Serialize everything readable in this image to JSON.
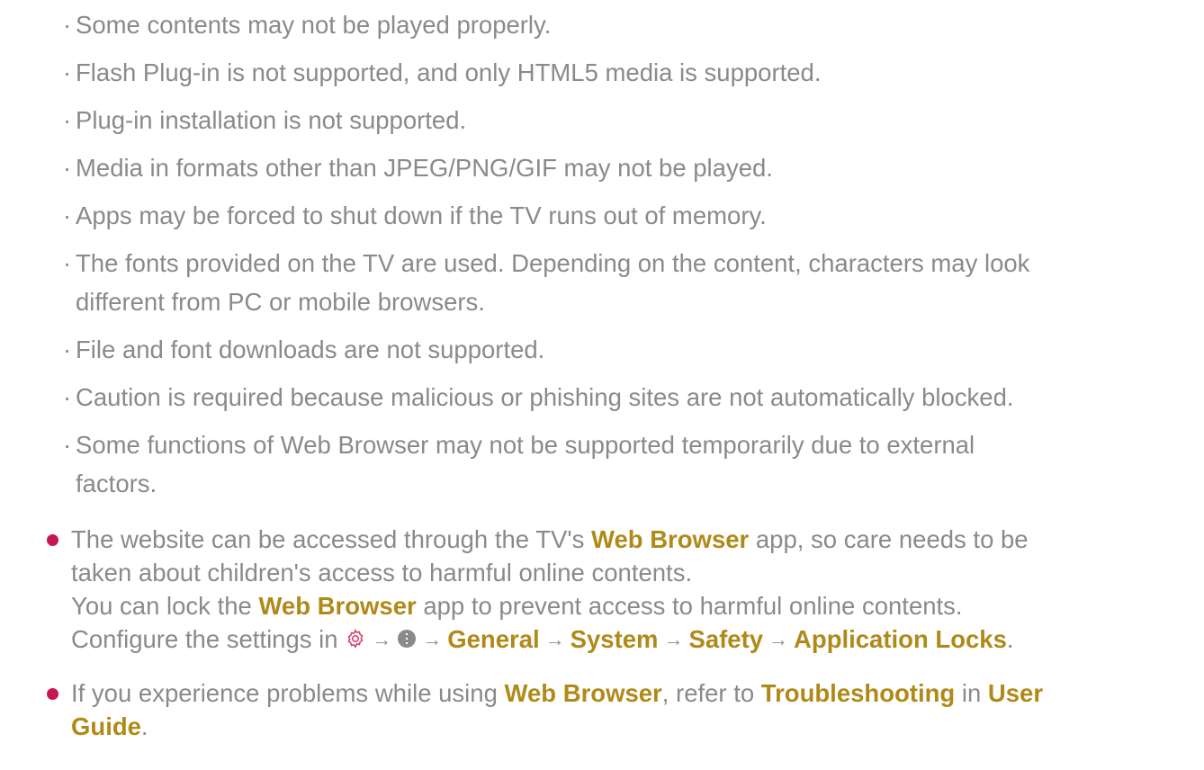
{
  "notes": [
    "Some contents may not be played properly.",
    "Flash Plug-in is not supported, and only HTML5 media is supported.",
    "Plug-in installation is not supported.",
    "Media in formats other than JPEG/PNG/GIF may not be played.",
    "Apps may be forced to shut down if the TV runs out of memory.",
    "The fonts provided on the TV are used. Depending on the content, characters may look",
    "different from PC or mobile browsers.",
    "File and font downloads are not supported.",
    "Caution is required because malicious or phishing sites are not automatically blocked.",
    "Some functions of Web Browser may not be supported temporarily due to external",
    "factors."
  ],
  "sub_dot": "·",
  "bullet1": {
    "l1_pre": "The website can be accessed through the TV's ",
    "l1_hl": "Web Browser",
    "l1_post": " app, so care needs to be",
    "l2": "taken about children's access to harmful online contents.",
    "l3_pre": "You can lock the ",
    "l3_hl": "Web Browser",
    "l3_post": " app to prevent access to harmful online contents.",
    "l4_pre": "Configure the settings in ",
    "path": [
      "General",
      "System",
      "Safety",
      "Application Locks"
    ],
    "l4_end": "."
  },
  "bullet2": {
    "pre": "If you experience problems while using ",
    "hl1": "Web Browser",
    "mid1": ", refer to ",
    "hl2": "Troubleshooting",
    "mid2": " in ",
    "hl3a": "User",
    "hl3b": "Guide",
    "end": "."
  },
  "arrow": "→",
  "icons": {
    "settings": "gear-icon",
    "more": "more-icon"
  },
  "colors": {
    "text": "#8a8a8a",
    "highlight": "#b08a19",
    "bullet": "#c8174f",
    "gear": "#d9456c"
  }
}
